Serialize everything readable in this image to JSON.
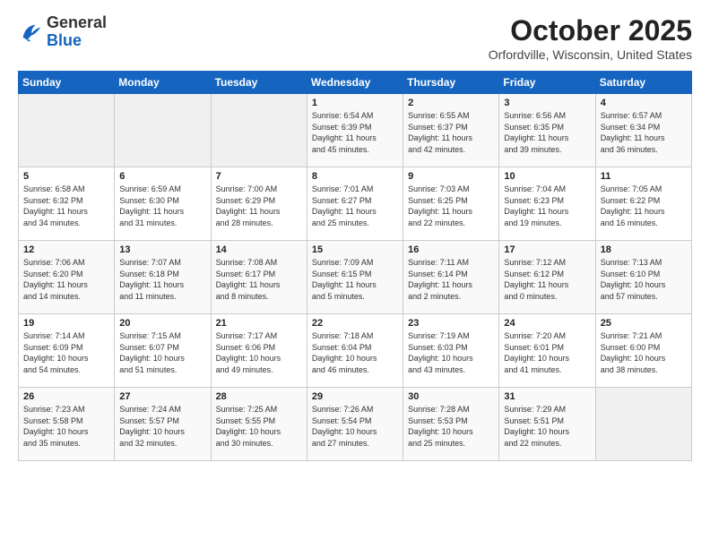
{
  "header": {
    "logo_general": "General",
    "logo_blue": "Blue",
    "month_title": "October 2025",
    "location": "Orfordville, Wisconsin, United States"
  },
  "days_of_week": [
    "Sunday",
    "Monday",
    "Tuesday",
    "Wednesday",
    "Thursday",
    "Friday",
    "Saturday"
  ],
  "weeks": [
    [
      {
        "day": "",
        "info": ""
      },
      {
        "day": "",
        "info": ""
      },
      {
        "day": "",
        "info": ""
      },
      {
        "day": "1",
        "info": "Sunrise: 6:54 AM\nSunset: 6:39 PM\nDaylight: 11 hours\nand 45 minutes."
      },
      {
        "day": "2",
        "info": "Sunrise: 6:55 AM\nSunset: 6:37 PM\nDaylight: 11 hours\nand 42 minutes."
      },
      {
        "day": "3",
        "info": "Sunrise: 6:56 AM\nSunset: 6:35 PM\nDaylight: 11 hours\nand 39 minutes."
      },
      {
        "day": "4",
        "info": "Sunrise: 6:57 AM\nSunset: 6:34 PM\nDaylight: 11 hours\nand 36 minutes."
      }
    ],
    [
      {
        "day": "5",
        "info": "Sunrise: 6:58 AM\nSunset: 6:32 PM\nDaylight: 11 hours\nand 34 minutes."
      },
      {
        "day": "6",
        "info": "Sunrise: 6:59 AM\nSunset: 6:30 PM\nDaylight: 11 hours\nand 31 minutes."
      },
      {
        "day": "7",
        "info": "Sunrise: 7:00 AM\nSunset: 6:29 PM\nDaylight: 11 hours\nand 28 minutes."
      },
      {
        "day": "8",
        "info": "Sunrise: 7:01 AM\nSunset: 6:27 PM\nDaylight: 11 hours\nand 25 minutes."
      },
      {
        "day": "9",
        "info": "Sunrise: 7:03 AM\nSunset: 6:25 PM\nDaylight: 11 hours\nand 22 minutes."
      },
      {
        "day": "10",
        "info": "Sunrise: 7:04 AM\nSunset: 6:23 PM\nDaylight: 11 hours\nand 19 minutes."
      },
      {
        "day": "11",
        "info": "Sunrise: 7:05 AM\nSunset: 6:22 PM\nDaylight: 11 hours\nand 16 minutes."
      }
    ],
    [
      {
        "day": "12",
        "info": "Sunrise: 7:06 AM\nSunset: 6:20 PM\nDaylight: 11 hours\nand 14 minutes."
      },
      {
        "day": "13",
        "info": "Sunrise: 7:07 AM\nSunset: 6:18 PM\nDaylight: 11 hours\nand 11 minutes."
      },
      {
        "day": "14",
        "info": "Sunrise: 7:08 AM\nSunset: 6:17 PM\nDaylight: 11 hours\nand 8 minutes."
      },
      {
        "day": "15",
        "info": "Sunrise: 7:09 AM\nSunset: 6:15 PM\nDaylight: 11 hours\nand 5 minutes."
      },
      {
        "day": "16",
        "info": "Sunrise: 7:11 AM\nSunset: 6:14 PM\nDaylight: 11 hours\nand 2 minutes."
      },
      {
        "day": "17",
        "info": "Sunrise: 7:12 AM\nSunset: 6:12 PM\nDaylight: 11 hours\nand 0 minutes."
      },
      {
        "day": "18",
        "info": "Sunrise: 7:13 AM\nSunset: 6:10 PM\nDaylight: 10 hours\nand 57 minutes."
      }
    ],
    [
      {
        "day": "19",
        "info": "Sunrise: 7:14 AM\nSunset: 6:09 PM\nDaylight: 10 hours\nand 54 minutes."
      },
      {
        "day": "20",
        "info": "Sunrise: 7:15 AM\nSunset: 6:07 PM\nDaylight: 10 hours\nand 51 minutes."
      },
      {
        "day": "21",
        "info": "Sunrise: 7:17 AM\nSunset: 6:06 PM\nDaylight: 10 hours\nand 49 minutes."
      },
      {
        "day": "22",
        "info": "Sunrise: 7:18 AM\nSunset: 6:04 PM\nDaylight: 10 hours\nand 46 minutes."
      },
      {
        "day": "23",
        "info": "Sunrise: 7:19 AM\nSunset: 6:03 PM\nDaylight: 10 hours\nand 43 minutes."
      },
      {
        "day": "24",
        "info": "Sunrise: 7:20 AM\nSunset: 6:01 PM\nDaylight: 10 hours\nand 41 minutes."
      },
      {
        "day": "25",
        "info": "Sunrise: 7:21 AM\nSunset: 6:00 PM\nDaylight: 10 hours\nand 38 minutes."
      }
    ],
    [
      {
        "day": "26",
        "info": "Sunrise: 7:23 AM\nSunset: 5:58 PM\nDaylight: 10 hours\nand 35 minutes."
      },
      {
        "day": "27",
        "info": "Sunrise: 7:24 AM\nSunset: 5:57 PM\nDaylight: 10 hours\nand 32 minutes."
      },
      {
        "day": "28",
        "info": "Sunrise: 7:25 AM\nSunset: 5:55 PM\nDaylight: 10 hours\nand 30 minutes."
      },
      {
        "day": "29",
        "info": "Sunrise: 7:26 AM\nSunset: 5:54 PM\nDaylight: 10 hours\nand 27 minutes."
      },
      {
        "day": "30",
        "info": "Sunrise: 7:28 AM\nSunset: 5:53 PM\nDaylight: 10 hours\nand 25 minutes."
      },
      {
        "day": "31",
        "info": "Sunrise: 7:29 AM\nSunset: 5:51 PM\nDaylight: 10 hours\nand 22 minutes."
      },
      {
        "day": "",
        "info": ""
      }
    ]
  ]
}
